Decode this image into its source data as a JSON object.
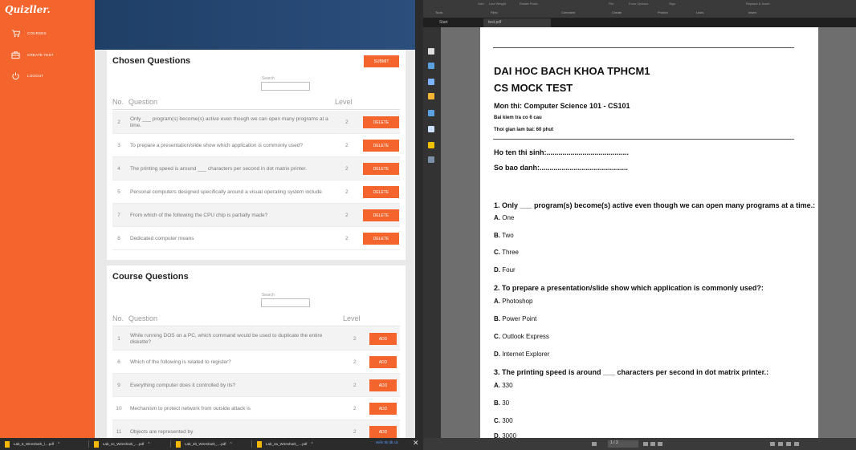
{
  "app": {
    "logo": "Quizller.",
    "sidebar": [
      {
        "label": "COURSES",
        "icon": "cart-icon"
      },
      {
        "label": "CREATE TEST",
        "icon": "briefcase-icon"
      },
      {
        "label": "LOGOUT",
        "icon": "power-icon"
      }
    ],
    "chosen": {
      "title": "Chosen Questions",
      "submit_label": "SUBMIT",
      "search_label": "Search",
      "col_no": "No.",
      "col_question": "Question",
      "col_level": "Level",
      "rows": [
        {
          "no": "2",
          "question": "Only ___ program(s) become(s) active even though we can open many programs at a time.",
          "level": "2",
          "action": "DELETE"
        },
        {
          "no": "3",
          "question": "To prepare a presentation/slide show which application is commonly used?",
          "level": "2",
          "action": "DELETE"
        },
        {
          "no": "4",
          "question": "The printing speed is around ___ characters per second in dot matrix printer.",
          "level": "2",
          "action": "DELETE"
        },
        {
          "no": "5",
          "question": "Personal computers designed specifically around a visual operating system include",
          "level": "2",
          "action": "DELETE"
        },
        {
          "no": "7",
          "question": "From which of the following the CPU chip is partially made?",
          "level": "2",
          "action": "DELETE"
        },
        {
          "no": "8",
          "question": "Dedicated computer means",
          "level": "2",
          "action": "DELETE"
        }
      ]
    },
    "course": {
      "title": "Course Questions",
      "search_label": "Search",
      "col_no": "No.",
      "col_question": "Question",
      "col_level": "Level",
      "rows": [
        {
          "no": "1",
          "question": "While running DOS on a PC, which command would be used to duplicate the entire diskette?",
          "level": "2",
          "action": "ADD"
        },
        {
          "no": "6",
          "question": "Which of the following is related to register?",
          "level": "2",
          "action": "ADD"
        },
        {
          "no": "9",
          "question": "Everything computer does it controlled by its?",
          "level": "2",
          "action": "ADD"
        },
        {
          "no": "10",
          "question": "Mechanism to protect network from outside attack is",
          "level": "2",
          "action": "ADD"
        },
        {
          "no": "11",
          "question": "Objects are represented by",
          "level": "2",
          "action": "ADD"
        }
      ]
    }
  },
  "taskbar": {
    "downloads": [
      "Lab_5_Wireshark_l....pdf",
      "Lab_4c_Wireshark_....pdf",
      "Lab_4b_Wireshark_....pdf",
      "Lab_4a_Wireshark_....pdf"
    ],
    "show_all": "Hiển thị tất cả",
    "close": "✕"
  },
  "viewer": {
    "ribbon": {
      "groups": [
        "Tools",
        "Files",
        "Comment",
        "Create",
        "Protect",
        "Links",
        "Insert"
      ],
      "options": [
        "Size",
        "Line Weight",
        "Rotate Flash",
        "File",
        "Form Options",
        "Sign",
        "Replace & Insert"
      ]
    },
    "tabs": [
      "Start",
      "test.pdf"
    ],
    "page_indicator": "1 / 2",
    "document": {
      "school": "DAI HOC BACH KHOA TPHCM1",
      "test_title": "CS MOCK TEST",
      "subject": "Mon thi: Computer Science 101 - CS101",
      "count": "Bai kiem tra co 6 cau",
      "time": "Thoi gian lam bai: 60 phut",
      "name_field": "Ho ten thi sinh:.........................................",
      "id_field": "So bao danh:............................................",
      "questions": [
        {
          "title": "1. Only ___ program(s) become(s) active even though we can open many programs at a time.:",
          "options": [
            {
              "letter": "A.",
              "text": "One"
            },
            {
              "letter": "B.",
              "text": "Two"
            },
            {
              "letter": "C.",
              "text": "Three"
            },
            {
              "letter": "D.",
              "text": "Four"
            }
          ]
        },
        {
          "title": "2. To prepare a presentation/slide show which application is commonly used?:",
          "options": [
            {
              "letter": "A.",
              "text": "Photoshop"
            },
            {
              "letter": "B.",
              "text": "Power Point"
            },
            {
              "letter": "C.",
              "text": "Outlook Express"
            },
            {
              "letter": "D.",
              "text": "Internet Explorer"
            }
          ]
        },
        {
          "title": "3. The printing speed is around ___ characters per second in dot matrix printer.:",
          "options": [
            {
              "letter": "A.",
              "text": "330"
            },
            {
              "letter": "B.",
              "text": "30"
            },
            {
              "letter": "C.",
              "text": "300"
            },
            {
              "letter": "D.",
              "text": "3000"
            }
          ]
        }
      ]
    }
  },
  "colors": {
    "accent": "#f4652e",
    "header": "#23446e",
    "taskbar": "#2b2b2b"
  }
}
